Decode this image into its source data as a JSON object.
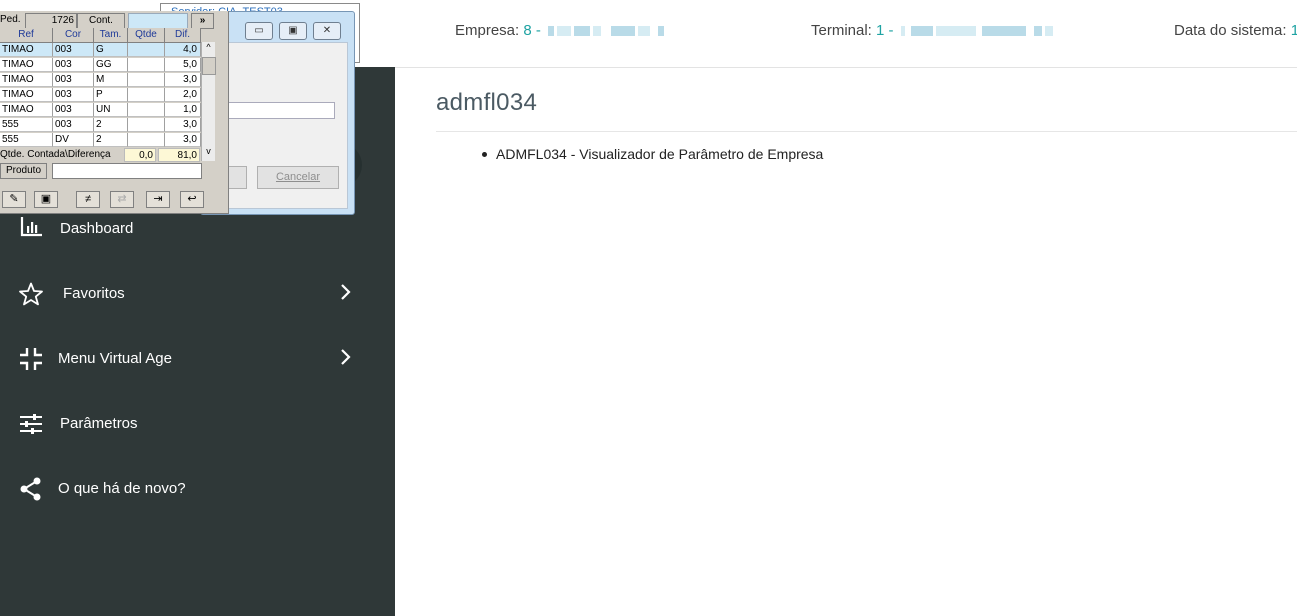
{
  "header": {
    "empresa_label": "Empresa:",
    "empresa_value": "8 -",
    "terminal_label": "Terminal:",
    "terminal_value": "1 -",
    "data_label": "Data do sistema:",
    "data_value": "1"
  },
  "sidebar": {
    "items": [
      {
        "label": "Dashboard",
        "icon": "bar-chart-icon"
      },
      {
        "label": "Favoritos",
        "icon": "star-icon"
      },
      {
        "label": "Menu Virtual Age",
        "icon": "compress-icon"
      },
      {
        "label": "Parâmetros",
        "icon": "sliders-icon"
      },
      {
        "label": "O que há de novo?",
        "icon": "share-icon"
      }
    ]
  },
  "content": {
    "title": "admfl034",
    "bullet": "ADMFL034 - Visualizador de Parâmetro de Empresa"
  },
  "tooltip": {
    "text": "Servidor: CIA_TEST03"
  },
  "dialog": {
    "cancel_label": "Cancelar"
  },
  "grid_window": {
    "ped_label": "Ped.",
    "ped_value": "1726",
    "cont_label": "Cont.",
    "more_label": "»",
    "columns": [
      "Ref",
      "Cor",
      "Tam.",
      "Qtde",
      "Dif."
    ],
    "rows": [
      [
        "TIMAO",
        "003",
        "G",
        "",
        "4,0"
      ],
      [
        "TIMAO",
        "003",
        "GG",
        "",
        "5,0"
      ],
      [
        "TIMAO",
        "003",
        "M",
        "",
        "3,0"
      ],
      [
        "TIMAO",
        "003",
        "P",
        "",
        "2,0"
      ],
      [
        "TIMAO",
        "003",
        "UN",
        "",
        "1,0"
      ],
      [
        "555",
        "003",
        "2",
        "",
        "3,0"
      ],
      [
        "555",
        "DV",
        "2",
        "",
        "3,0"
      ]
    ],
    "totals_label": "Qtde. Contada\\Diferença",
    "totals_counted": "0,0",
    "totals_diff": "81,0",
    "produto_label": "Produto",
    "tools": [
      "brush-icon",
      "save-icon",
      "not-equal-icon",
      "transfer-icon",
      "exit-icon",
      "back-icon"
    ]
  }
}
